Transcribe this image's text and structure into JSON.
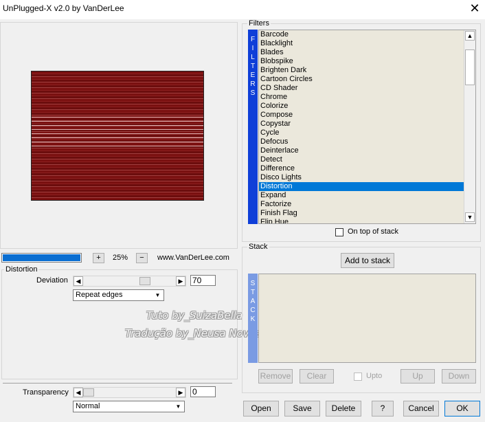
{
  "window": {
    "title": "UnPlugged-X v2.0 by VanDerLee",
    "close_icon": "close-icon"
  },
  "preview": {
    "progress_percent": 100,
    "zoom_in": "+",
    "zoom_out": "−",
    "zoom_level": "25%",
    "url": "www.VanDerLee.com"
  },
  "filter_params": {
    "group_label": "Distortion",
    "deviation_label": "Deviation",
    "deviation_value": "70",
    "edge_mode": "Repeat edges",
    "transparency_label": "Transparency",
    "transparency_value": "0",
    "blend_mode": "Normal"
  },
  "filters": {
    "group_label": "Filters",
    "tab_label": "FILTERS",
    "items": [
      "Barcode",
      "Blacklight",
      "Blades",
      "Blobspike",
      "Brighten Dark",
      "Cartoon Circles",
      "CD Shader",
      "Chrome",
      "Colorize",
      "Compose",
      "Copystar",
      "Cycle",
      "Defocus",
      "Deinterlace",
      "Detect",
      "Difference",
      "Disco Lights",
      "Distortion",
      "Expand",
      "Factorize",
      "Finish Flag",
      "Flip Hue"
    ],
    "selected": "Distortion",
    "on_top_label": "On top of stack"
  },
  "stack": {
    "group_label": "Stack",
    "add_label": "Add to stack",
    "tab_label": "STACK",
    "remove_label": "Remove",
    "clear_label": "Clear",
    "upto_label": "Upto",
    "up_label": "Up",
    "down_label": "Down"
  },
  "footer": {
    "open": "Open",
    "save": "Save",
    "delete": "Delete",
    "help": "?",
    "cancel": "Cancel",
    "ok": "OK"
  },
  "watermark": {
    "line1": "Tuto by_SuizaBella",
    "line2": "Tradução by_Neusa Novaes"
  }
}
